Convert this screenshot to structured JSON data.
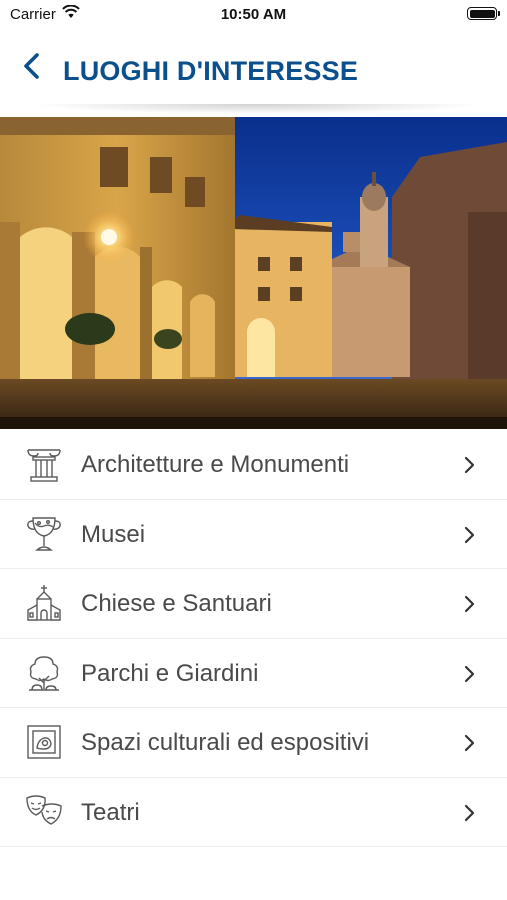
{
  "status_bar": {
    "carrier": "Carrier",
    "time": "10:50 AM"
  },
  "nav": {
    "title": "LUOGHI D'INTERESSE",
    "back_icon": "chevron-left-icon",
    "accent": "#0b4f8c"
  },
  "hero": {
    "description_icon": "city-square-photo"
  },
  "categories": [
    {
      "label": "Architetture e Monumenti",
      "icon": "column-icon"
    },
    {
      "label": "Musei",
      "icon": "trophy-icon"
    },
    {
      "label": "Chiese e Santuari",
      "icon": "church-icon"
    },
    {
      "label": "Parchi e Giardini",
      "icon": "tree-icon"
    },
    {
      "label": "Spazi culturali ed espositivi",
      "icon": "frame-icon"
    },
    {
      "label": "Teatri",
      "icon": "theater-masks-icon"
    }
  ]
}
